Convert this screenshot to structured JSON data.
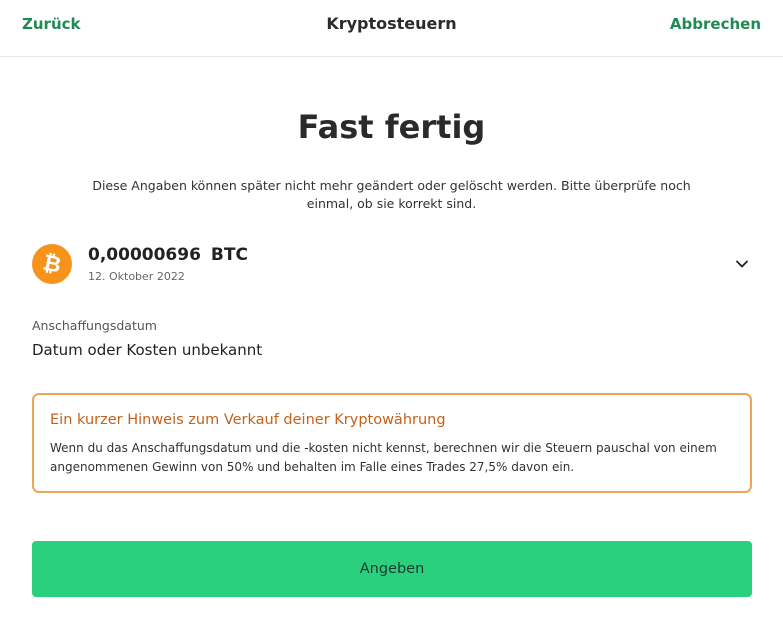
{
  "header": {
    "back_label": "Zurück",
    "title": "Kryptosteuern",
    "cancel_label": "Abbrechen"
  },
  "main": {
    "heading": "Fast fertig",
    "description": "Diese Angaben können später nicht mehr geändert oder gelöscht werden. Bitte überprüfe noch einmal, ob sie korrekt sind."
  },
  "asset": {
    "amount": "0,00000696",
    "symbol": "BTC",
    "date": "12. Oktober 2022",
    "logo_glyph": "₿",
    "icon": "bitcoin-icon",
    "brand_color": "#f7931a"
  },
  "acquisition": {
    "label": "Anschaffungsdatum",
    "value": "Datum oder Kosten unbekannt"
  },
  "notice": {
    "title": "Ein kurzer Hinweis zum Verkauf deiner Kryptowährung",
    "body": "Wenn du das Anschaffungsdatum und die -kosten nicht kennst, berechnen wir die Steuern pauschal von einem angenommenen Gewinn von 50% und behalten im Falle eines Trades 27,5% davon ein.",
    "border_color": "#f0a35b"
  },
  "submit": {
    "label": "Angeben",
    "color": "#2bd07f"
  },
  "colors": {
    "link": "#1f8a55"
  }
}
